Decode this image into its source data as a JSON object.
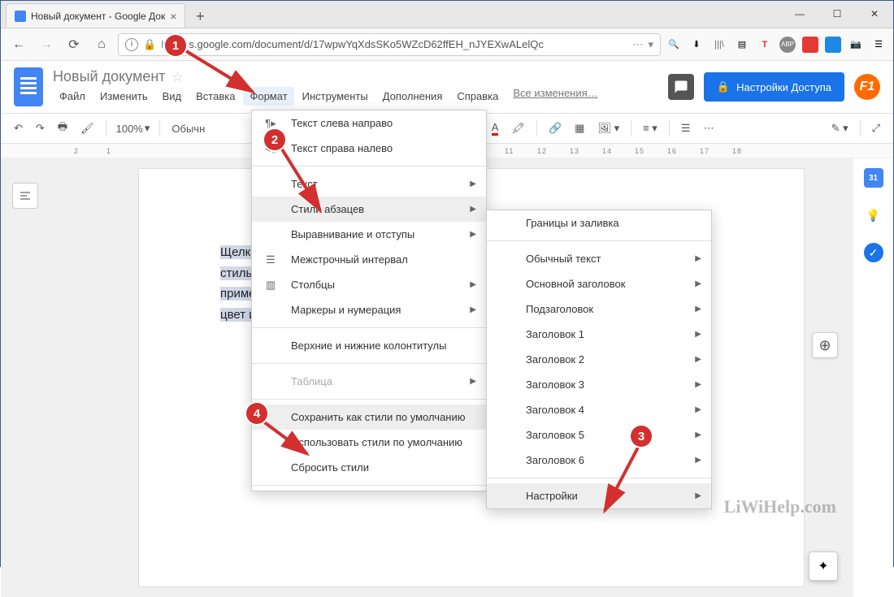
{
  "browser": {
    "tab_title": "Новый документ - Google Док",
    "url_prefix": "https",
    "url_display": "s.google.com/document/d/17wpwYqXdsSKo5WZcD62ffEH_nJYEXwALelQc"
  },
  "docs": {
    "title": "Новый документ",
    "menus": [
      "Файл",
      "Изменить",
      "Вид",
      "Вставка",
      "Формат",
      "Инструменты",
      "Дополнения",
      "Справка"
    ],
    "changes": "Все изменения…",
    "share": "Настройки Доступа"
  },
  "toolbar": {
    "zoom": "100%",
    "style": "Обычн"
  },
  "page_text": {
    "l1": "Щелкните вы",
    "l2": "стиль основн",
    "l3": "примените ф",
    "l4": "цвет и т.п."
  },
  "menu_format": {
    "ltr": "Текст слева направо",
    "rtl": "Текст справа налево",
    "text": "Текст",
    "para_styles": "Стили абзацев",
    "align": "Выравнивание и отступы",
    "line_spacing": "Межстрочный интервал",
    "columns": "Столбцы",
    "bullets": "Маркеры и нумерация",
    "headers": "Верхние и нижние колонтитулы",
    "table": "Таблица",
    "save_default": "Сохранить как стили по умолчанию",
    "use_default": "Использовать стили по умолчанию",
    "reset": "Сбросить стили"
  },
  "menu_styles": {
    "borders": "Границы и заливка",
    "normal": "Обычный текст",
    "title": "Основной заголовок",
    "subtitle": "Подзаголовок",
    "h1": "Заголовок 1",
    "h2": "Заголовок 2",
    "h3": "Заголовок 3",
    "h4": "Заголовок 4",
    "h5": "Заголовок 5",
    "h6": "Заголовок 6",
    "settings": "Настройки"
  },
  "badges": {
    "b1": "1",
    "b2": "2",
    "b3": "3",
    "b4": "4"
  },
  "watermark": "LiWiHelp.com",
  "calendar_day": "31"
}
